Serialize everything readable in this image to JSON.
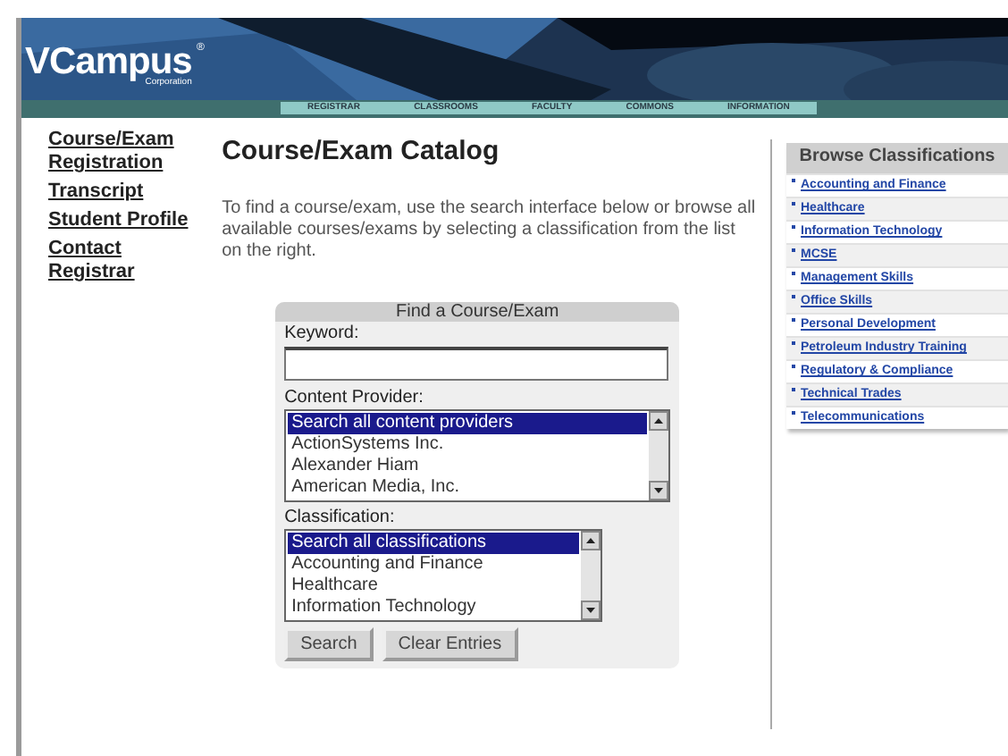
{
  "header": {
    "logo": "VCampus",
    "logo_mark": "®",
    "logo_sub": "Corporation",
    "nav": [
      "REGISTRAR",
      "CLASSROOMS",
      "FACULTY",
      "COMMONS",
      "INFORMATION"
    ]
  },
  "sidebar": {
    "links": [
      "Course/Exam Registration",
      "Transcript",
      "Student Profile",
      "Contact Registrar"
    ]
  },
  "main": {
    "title": "Course/Exam Catalog",
    "intro": "To find a course/exam, use the search interface below or browse all available courses/exams by selecting a classification from the list on the right.",
    "search_box": {
      "title": "Find a Course/Exam",
      "keyword_label": "Keyword:",
      "provider_label": "Content Provider:",
      "providers": [
        {
          "label": "Search all content providers",
          "selected": true
        },
        {
          "label": "ActionSystems Inc.",
          "selected": false
        },
        {
          "label": "Alexander Hiam",
          "selected": false
        },
        {
          "label": "American Media, Inc.",
          "selected": false
        }
      ],
      "classification_label": "Classification:",
      "classifications": [
        {
          "label": "Search all classifications",
          "selected": true
        },
        {
          "label": "Accounting and Finance",
          "selected": false
        },
        {
          "label": "Healthcare",
          "selected": false
        },
        {
          "label": "Information Technology",
          "selected": false
        }
      ],
      "buttons": [
        "Search",
        "Clear Entries"
      ]
    }
  },
  "browse": {
    "title": "Browse Classifications",
    "items": [
      "Accounting and Finance",
      "Healthcare",
      "Information Technology",
      "MCSE",
      "Management Skills",
      "Office Skills",
      "Personal Development",
      "Petroleum Industry Training",
      "Regulatory & Compliance",
      "Technical Trades",
      "Telecommunications"
    ]
  }
}
